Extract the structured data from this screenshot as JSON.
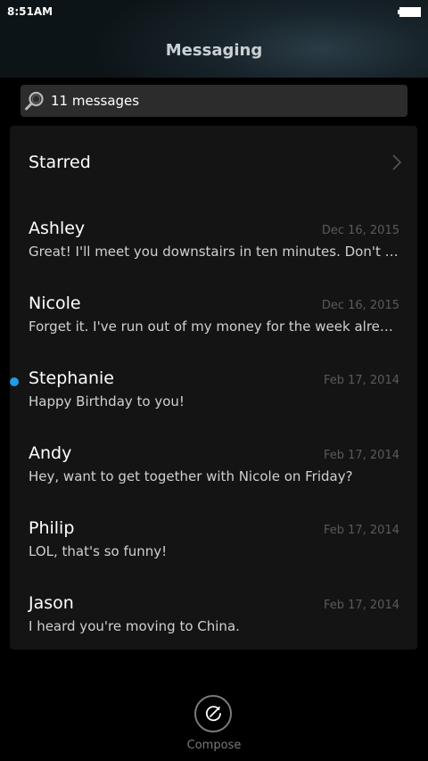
{
  "status_bar": {
    "time": "8:51AM",
    "battery_icon": "battery-full-icon"
  },
  "header": {
    "title": "Messaging"
  },
  "search": {
    "icon": "search-icon",
    "text": "11 messages"
  },
  "starred": {
    "label": "Starred",
    "icon": "chevron-right-icon"
  },
  "threads": [
    {
      "name": "Ashley",
      "date": "Dec 16, 2015",
      "preview": "Great! I'll meet you downstairs in ten minutes. Don't forget to bring the tickets.",
      "unread": false
    },
    {
      "name": "Nicole",
      "date": "Dec 16, 2015",
      "preview": "Forget it. I've run out of my money for the week already.",
      "unread": false
    },
    {
      "name": "Stephanie",
      "date": "Feb 17, 2014",
      "preview": "Happy Birthday to you!",
      "unread": true
    },
    {
      "name": "Andy",
      "date": "Feb 17, 2014",
      "preview": "Hey, want to get together with Nicole on Friday?",
      "unread": false
    },
    {
      "name": "Philip",
      "date": "Feb 17, 2014",
      "preview": "LOL, that's so funny!",
      "unread": false
    },
    {
      "name": "Jason",
      "date": "Feb 17, 2014",
      "preview": "I heard you're moving to China.",
      "unread": false
    }
  ],
  "compose": {
    "label": "Compose",
    "icon": "compose-icon"
  },
  "colors": {
    "unread_dot": "#1e9be9",
    "background": "#000000",
    "card": "#141414",
    "date_text": "#5a5a5a"
  }
}
